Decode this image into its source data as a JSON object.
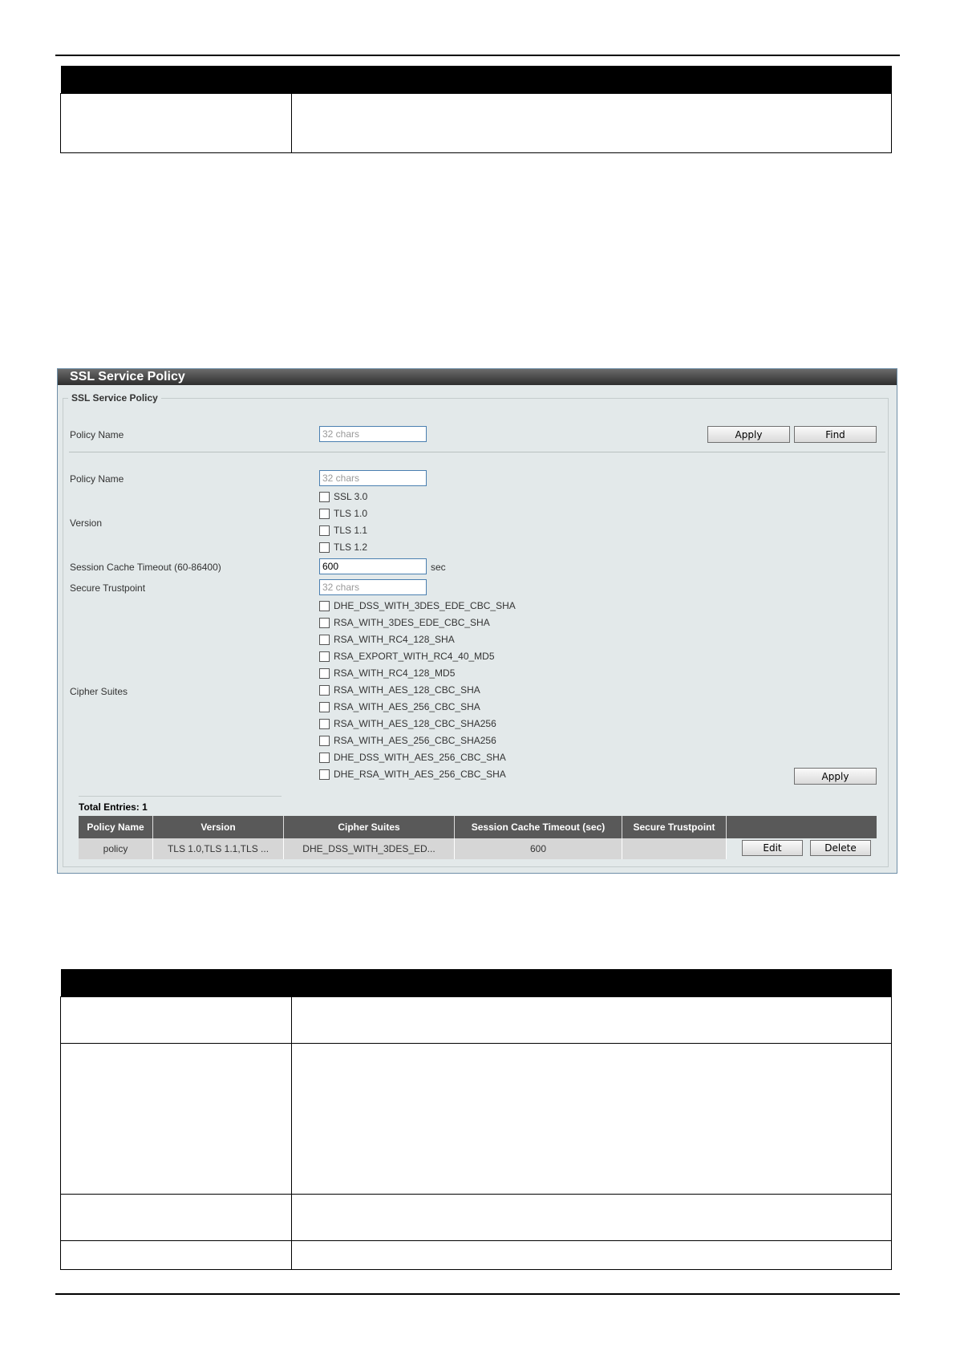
{
  "panel": {
    "title": "SSL Service Policy",
    "legend": "SSL Service Policy",
    "find_row": {
      "policy_name_label": "Policy Name",
      "policy_name_placeholder": "32 chars",
      "apply_label": "Apply",
      "find_label": "Find"
    },
    "form": {
      "policy_name_label": "Policy Name",
      "policy_name_placeholder": "32 chars",
      "version_label": "Version",
      "versions": [
        "SSL 3.0",
        "TLS 1.0",
        "TLS 1.1",
        "TLS 1.2"
      ],
      "session_timeout_label": "Session Cache Timeout (60-86400)",
      "session_timeout_value": "600",
      "session_timeout_unit": "sec",
      "trustpoint_label": "Secure Trustpoint",
      "trustpoint_placeholder": "32 chars",
      "cipher_label": "Cipher Suites",
      "ciphers": [
        "DHE_DSS_WITH_3DES_EDE_CBC_SHA",
        "RSA_WITH_3DES_EDE_CBC_SHA",
        "RSA_WITH_RC4_128_SHA",
        "RSA_EXPORT_WITH_RC4_40_MD5",
        "RSA_WITH_RC4_128_MD5",
        "RSA_WITH_AES_128_CBC_SHA",
        "RSA_WITH_AES_256_CBC_SHA",
        "RSA_WITH_AES_128_CBC_SHA256",
        "RSA_WITH_AES_256_CBC_SHA256",
        "DHE_DSS_WITH_AES_256_CBC_SHA",
        "DHE_RSA_WITH_AES_256_CBC_SHA"
      ],
      "apply_label": "Apply"
    },
    "total_entries": "Total Entries: 1",
    "table": {
      "headers": [
        "Policy Name",
        "Version",
        "Cipher Suites",
        "Session Cache Timeout (sec)",
        "Secure Trustpoint",
        ""
      ],
      "rows": [
        {
          "policy_name": "policy",
          "version": "TLS 1.0,TLS 1.1,TLS ...",
          "cipher_suites": "DHE_DSS_WITH_3DES_ED...",
          "timeout": "600",
          "trustpoint": "",
          "edit_label": "Edit",
          "delete_label": "Delete"
        }
      ]
    }
  }
}
